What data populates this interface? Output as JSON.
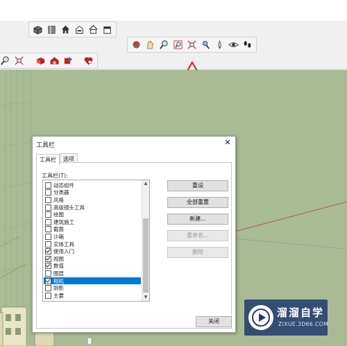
{
  "dialog": {
    "title": "工具栏",
    "close_glyph": "✕",
    "tabs": [
      {
        "label": "工具栏",
        "active": true
      },
      {
        "label": "选项",
        "active": false
      }
    ],
    "list_label": "工具栏(T):",
    "items": [
      {
        "label": "动态组件",
        "checked": false,
        "selected": false
      },
      {
        "label": "分类器",
        "checked": false,
        "selected": false
      },
      {
        "label": "风格",
        "checked": false,
        "selected": false
      },
      {
        "label": "高级镜头工具",
        "checked": false,
        "selected": false
      },
      {
        "label": "绘图",
        "checked": false,
        "selected": false
      },
      {
        "label": "建筑施工",
        "checked": false,
        "selected": false
      },
      {
        "label": "截面",
        "checked": false,
        "selected": false
      },
      {
        "label": "沙箱",
        "checked": false,
        "selected": false
      },
      {
        "label": "实体工具",
        "checked": false,
        "selected": false
      },
      {
        "label": "使用入门",
        "checked": true,
        "selected": false
      },
      {
        "label": "视图",
        "checked": true,
        "selected": false
      },
      {
        "label": "数值",
        "checked": true,
        "selected": false
      },
      {
        "label": "图层",
        "checked": false,
        "selected": false
      },
      {
        "label": "相机",
        "checked": true,
        "selected": true
      },
      {
        "label": "阴影",
        "checked": false,
        "selected": false
      },
      {
        "label": "主要",
        "checked": false,
        "selected": false
      }
    ],
    "buttons": {
      "reset": "重设",
      "reset_all": "全部重置",
      "new": "新建...",
      "rename": "重命名...",
      "delete": "删除",
      "close": "关闭"
    }
  },
  "toolbars": {
    "views_icons": [
      "iso-view-icon",
      "top-view-icon",
      "front-view-icon",
      "right-view-icon",
      "back-view-icon",
      "left-view-icon"
    ],
    "camera_icons": [
      "orbit-icon",
      "pan-icon",
      "zoom-icon",
      "zoom-window-icon",
      "zoom-extents-icon",
      "position-camera-icon",
      "look-around-icon",
      "walk-icon",
      "eye-icon",
      "footprints-icon"
    ],
    "left_icons": [
      "zoom-icon",
      "zoom-extents-icon",
      "section-plane-icon",
      "warehouse-icon",
      "share-model-icon",
      "extension-warehouse-icon"
    ]
  },
  "annotation": {
    "arrow_color": "#e02424"
  },
  "watermark": {
    "brand": "溜溜自学",
    "url": "ZIXUE.3D66.COM"
  },
  "colors": {
    "viewport": "#a8bb95",
    "selection": "#0078d7"
  }
}
